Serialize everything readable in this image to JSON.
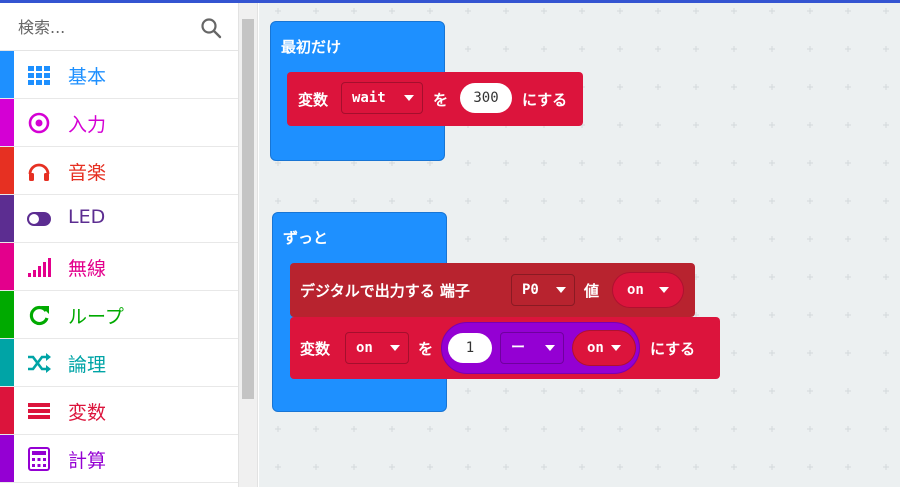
{
  "search": {
    "placeholder": "検索..."
  },
  "categories": [
    {
      "label": "基本",
      "icon": "grid-icon",
      "color": "#1E90FF"
    },
    {
      "label": "入力",
      "icon": "target-icon",
      "color": "#D400D4"
    },
    {
      "label": "音楽",
      "icon": "headphones-icon",
      "color": "#E63022"
    },
    {
      "label": "LED",
      "icon": "toggle-icon",
      "color": "#5C2D91"
    },
    {
      "label": "無線",
      "icon": "signal-icon",
      "color": "#E3008C"
    },
    {
      "label": "ループ",
      "icon": "refresh-icon",
      "color": "#00AA00"
    },
    {
      "label": "論理",
      "icon": "shuffle-icon",
      "color": "#00A4A6"
    },
    {
      "label": "変数",
      "icon": "list-icon",
      "color": "#DC143C"
    },
    {
      "label": "計算",
      "icon": "calculator-icon",
      "color": "#9400D3"
    }
  ],
  "colors": {
    "variables": "#DC143C",
    "pins": "#B8232F",
    "math": "#9400D3",
    "hat": "#1E90FF"
  },
  "workspace": {
    "on_start": {
      "title": "最初だけ",
      "set_block": {
        "label": "変数",
        "variable": "wait",
        "to_label": "を",
        "value": "300",
        "suffix": "にする"
      }
    },
    "forever": {
      "title": "ずっと",
      "digital_write": {
        "label": "デジタルで出力する 端子",
        "pin": "P0",
        "value_label": "値",
        "value": "on"
      },
      "set_block": {
        "label": "変数",
        "variable": "on",
        "to_label": "を",
        "left": "1",
        "operator": "ー",
        "right": "on",
        "suffix": "にする"
      }
    }
  }
}
